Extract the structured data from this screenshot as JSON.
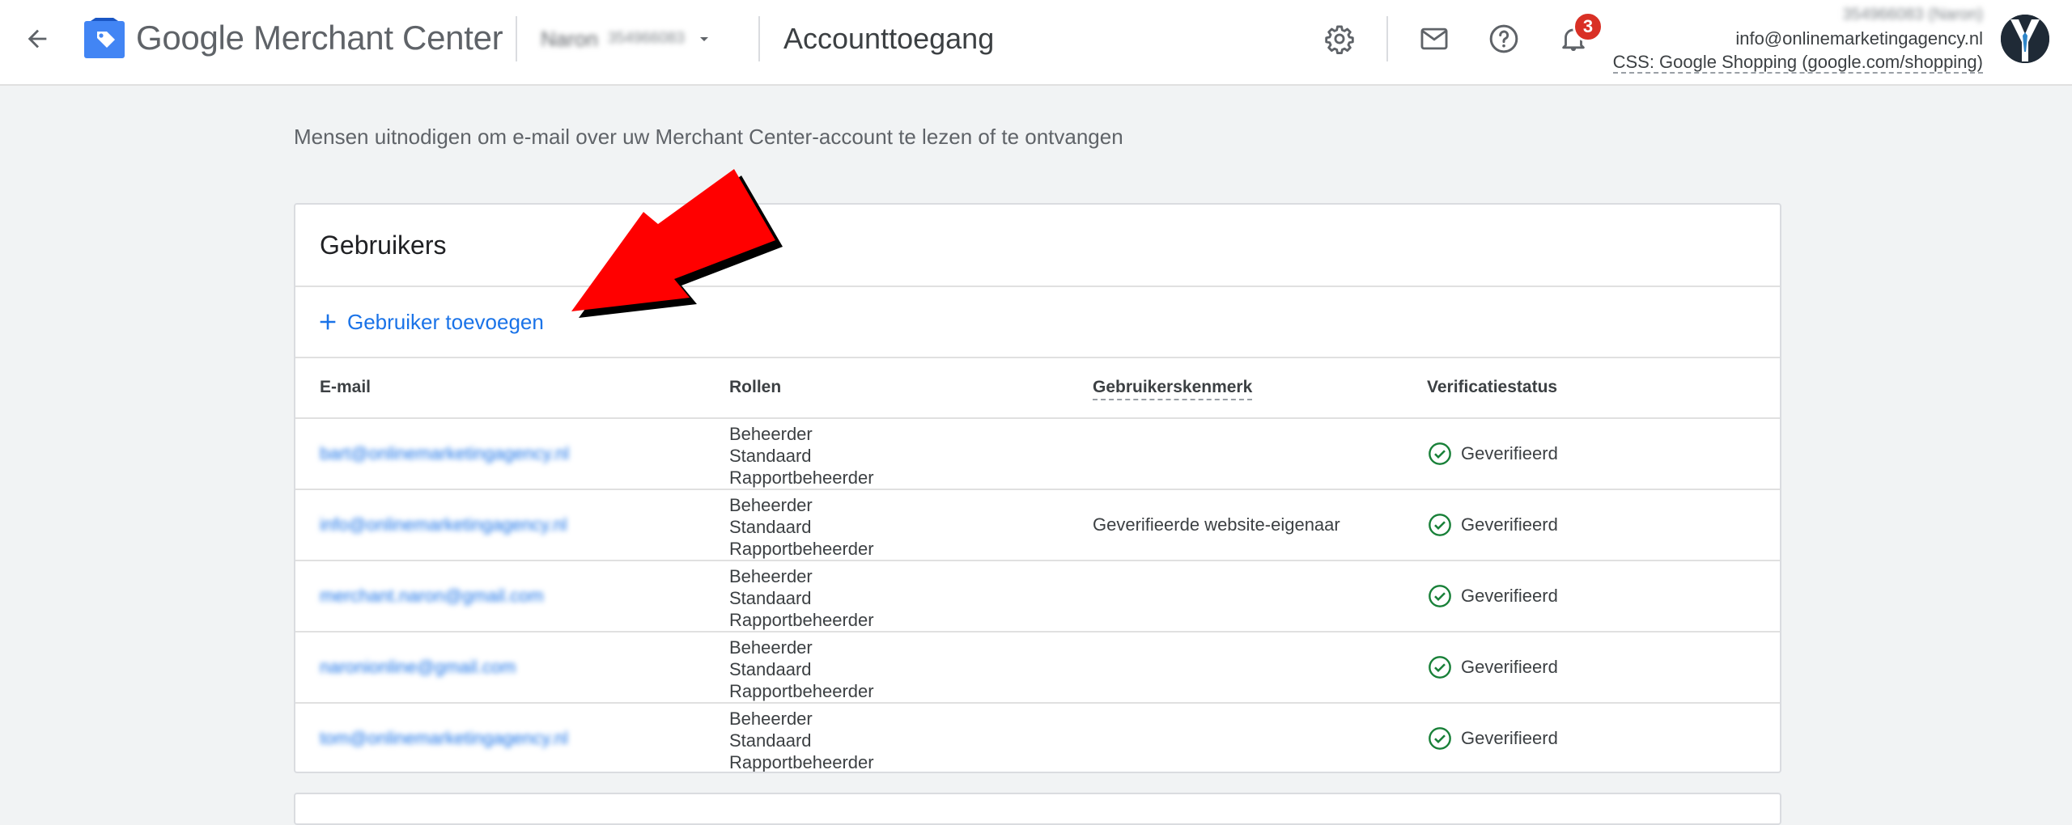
{
  "header": {
    "brand_google": "Google",
    "brand_product": "Merchant Center",
    "account_name": "Naron",
    "account_id": "354966083",
    "page_title": "Accounttoegang",
    "notification_count": "3",
    "account_top_line": "354966083 (Naron)",
    "account_email": "info@onlinemarketingagency.nl",
    "account_css": "CSS: Google Shopping (google.com/shopping)",
    "icons": [
      "arrow-back-icon",
      "merchant-center-logo-icon",
      "dropdown-icon",
      "gear-icon",
      "mail-icon",
      "help-icon",
      "bell-icon"
    ]
  },
  "main": {
    "subtitle": "Mensen uitnodigen om e-mail over uw Merchant Center-account te lezen of te ontvangen",
    "card_title": "Gebruikers",
    "add_user_label": "Gebruiker toevoegen",
    "columns": {
      "email": "E-mail",
      "roles": "Rollen",
      "attribute": "Gebruikerskenmerk",
      "status": "Verificatiestatus"
    },
    "users": [
      {
        "email": "bart@onlinemarketingagency.nl",
        "roles": [
          "Beheerder",
          "Standaard",
          "Rapportbeheerder"
        ],
        "attribute": "",
        "status": "Geverifieerd"
      },
      {
        "email": "info@onlinemarketingagency.nl",
        "roles": [
          "Beheerder",
          "Standaard",
          "Rapportbeheerder"
        ],
        "attribute": "Geverifieerde website-eigenaar",
        "status": "Geverifieerd"
      },
      {
        "email": "merchant.naron@gmail.com",
        "roles": [
          "Beheerder",
          "Standaard",
          "Rapportbeheerder"
        ],
        "attribute": "",
        "status": "Geverifieerd"
      },
      {
        "email": "naronionline@gmail.com",
        "roles": [
          "Beheerder",
          "Standaard",
          "Rapportbeheerder"
        ],
        "attribute": "",
        "status": "Geverifieerd"
      },
      {
        "email": "tom@onlinemarketingagency.nl",
        "roles": [
          "Beheerder",
          "Standaard",
          "Rapportbeheerder"
        ],
        "attribute": "",
        "status": "Geverifieerd"
      }
    ]
  },
  "colors": {
    "link_blue": "#1a73e8",
    "verified_green": "#188038",
    "badge_red": "#d93025",
    "annotation_red": "#ff0000"
  }
}
